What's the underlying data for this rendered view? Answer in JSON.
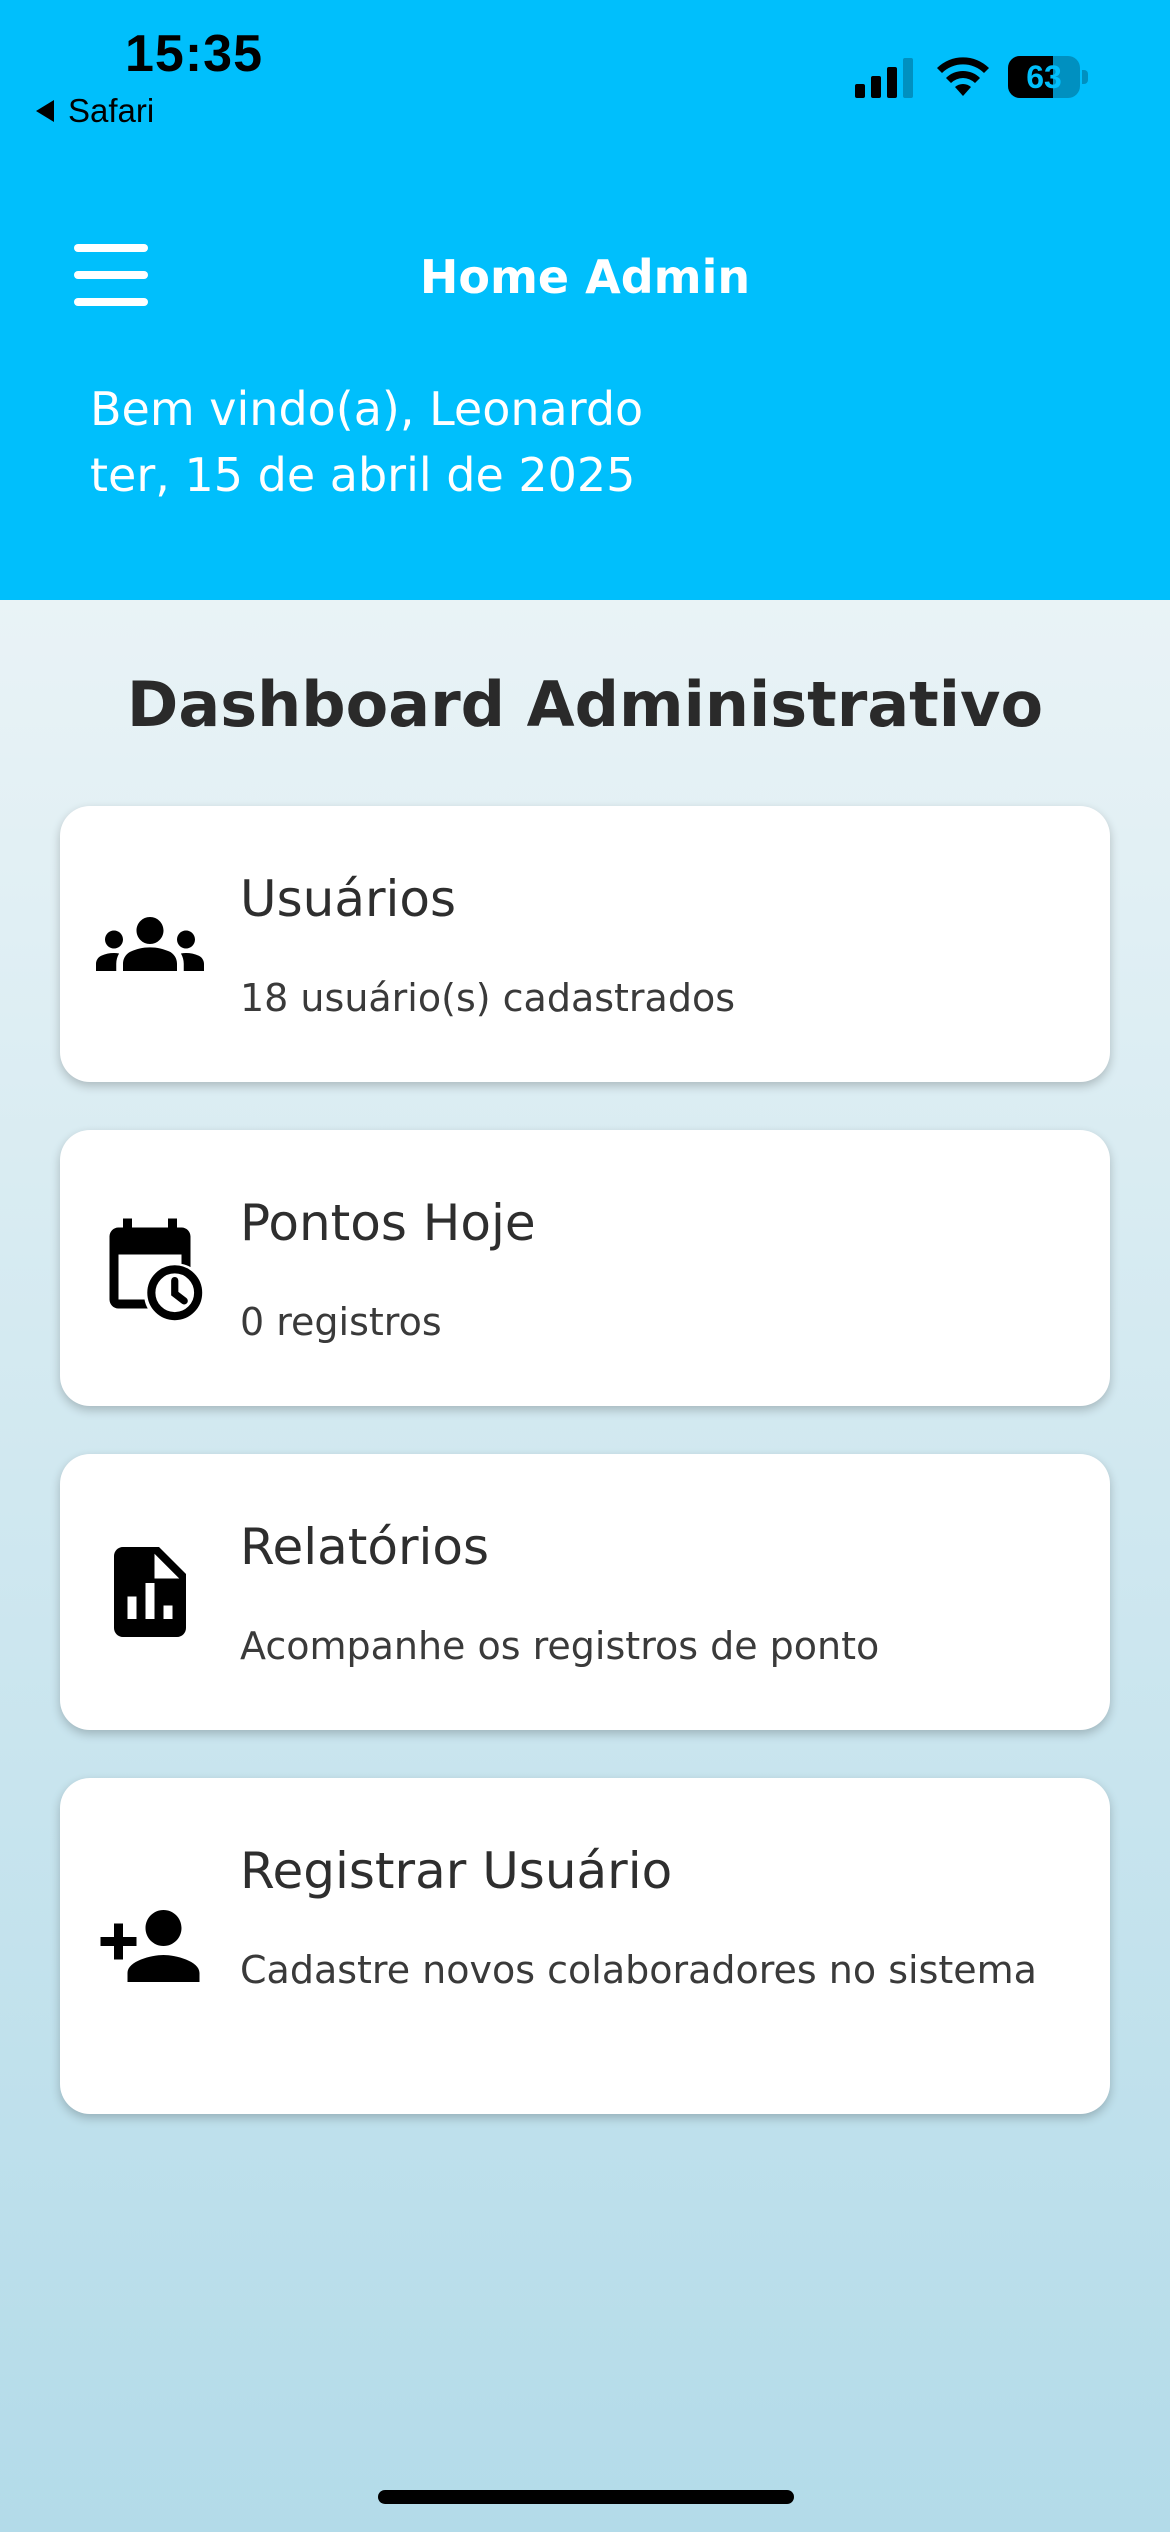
{
  "status_bar": {
    "time": "15:35",
    "back_app": "Safari",
    "battery_percent": "63",
    "battery_level": 0.63
  },
  "header": {
    "title": "Home Admin",
    "welcome": "Bem vindo(a), Leonardo",
    "date": "ter, 15 de abril de 2025",
    "background_color": "#00bffc"
  },
  "dashboard": {
    "title": "Dashboard Administrativo",
    "cards": [
      {
        "icon": "users-group-icon",
        "title": "Usuários",
        "subtitle": "18 usuário(s) cadastrados"
      },
      {
        "icon": "calendar-clock-icon",
        "title": "Pontos Hoje",
        "subtitle": "0 registros"
      },
      {
        "icon": "report-document-icon",
        "title": "Relatórios",
        "subtitle": "Acompanhe os registros de ponto"
      },
      {
        "icon": "person-add-icon",
        "title": "Registrar Usuário",
        "subtitle": "Cadastre novos colaboradores no sistema"
      }
    ]
  }
}
